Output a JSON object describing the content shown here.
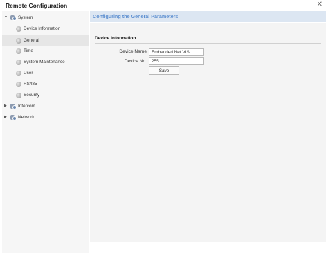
{
  "window": {
    "title": "Remote Configuration",
    "close_glyph": "✕"
  },
  "sidebar": {
    "system": {
      "label": "System",
      "arrow": "▼",
      "icon": "network-group-icon"
    },
    "items": [
      {
        "label": "Device Information",
        "icon": "gear-icon"
      },
      {
        "label": "General",
        "icon": "gear-icon",
        "selected": true
      },
      {
        "label": "Time",
        "icon": "gear-icon"
      },
      {
        "label": "System Maintenance",
        "icon": "gear-icon"
      },
      {
        "label": "User",
        "icon": "gear-icon"
      },
      {
        "label": "RS485",
        "icon": "gear-icon"
      },
      {
        "label": "Security",
        "icon": "gear-icon"
      }
    ],
    "intercom": {
      "label": "Intercom",
      "arrow": "▶",
      "icon": "network-group-icon"
    },
    "network": {
      "label": "Network",
      "arrow": "▶",
      "icon": "network-group-icon"
    }
  },
  "main": {
    "header_title": "Configuring the General Parameters",
    "section_title": "Device Information",
    "fields": [
      {
        "label": "Device Name",
        "value": "Embedded Net VIS"
      },
      {
        "label": "Device No.",
        "value": "255"
      }
    ],
    "save_label": "Save"
  },
  "colors": {
    "accent": "#5d8fd0",
    "header_bg": "#dce6f2",
    "selected_bg": "#e6e6e6"
  }
}
